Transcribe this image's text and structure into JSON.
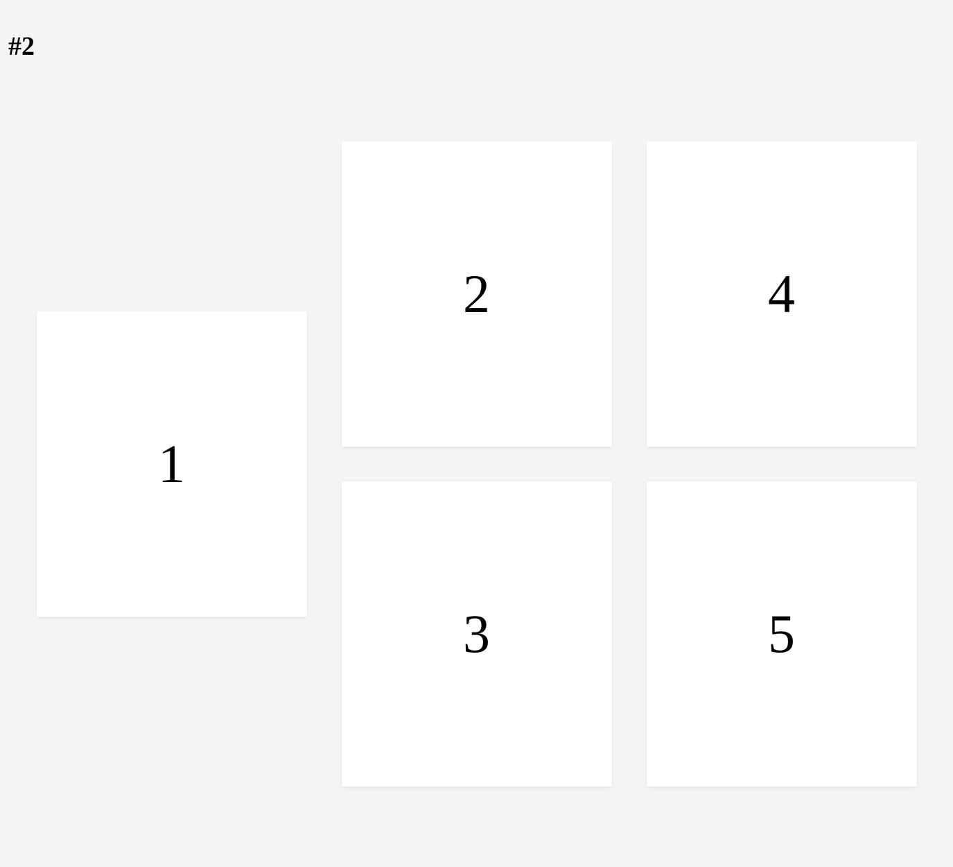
{
  "title": "#2",
  "cards": {
    "c1": "1",
    "c2": "2",
    "c3": "3",
    "c4": "4",
    "c5": "5"
  }
}
